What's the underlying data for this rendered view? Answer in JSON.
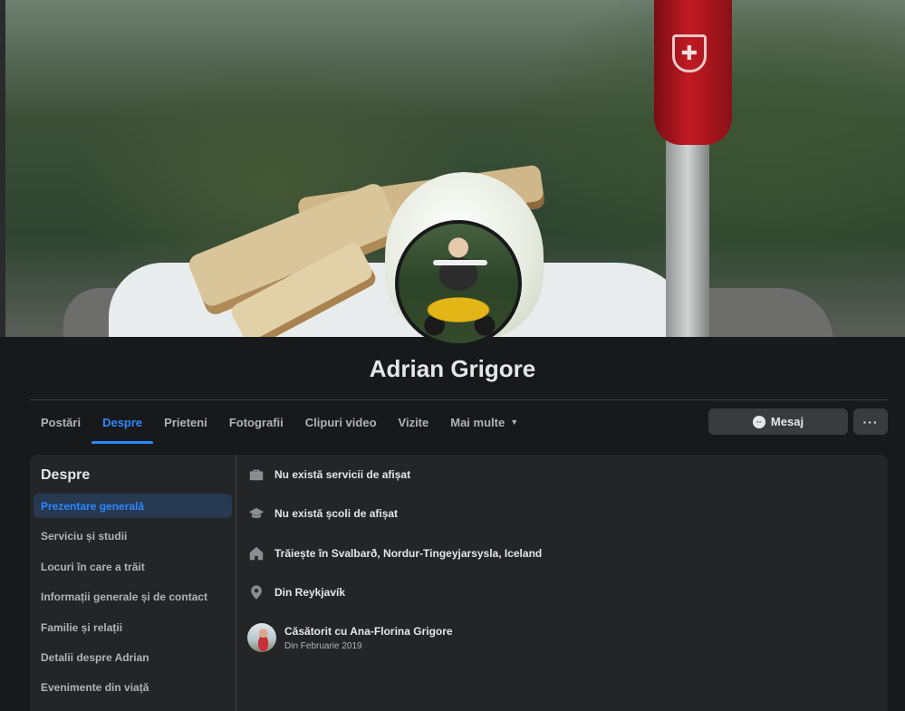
{
  "profile": {
    "name": "Adrian Grigore"
  },
  "tabs": [
    {
      "label": "Postări"
    },
    {
      "label": "Despre"
    },
    {
      "label": "Prieteni"
    },
    {
      "label": "Fotografii"
    },
    {
      "label": "Clipuri video"
    },
    {
      "label": "Vizite"
    },
    {
      "label": "Mai multe"
    }
  ],
  "actions": {
    "message_label": "Mesaj",
    "more_label": "···"
  },
  "about": {
    "title": "Despre",
    "menu": [
      {
        "label": "Prezentare generală"
      },
      {
        "label": "Serviciu și studii"
      },
      {
        "label": "Locuri în care a trăit"
      },
      {
        "label": "Informații generale și de contact"
      },
      {
        "label": "Familie și relații"
      },
      {
        "label": "Detalii despre Adrian"
      },
      {
        "label": "Evenimente din viață"
      }
    ],
    "overview": [
      {
        "icon": "briefcase-icon",
        "text": "Nu există servicii de afișat"
      },
      {
        "icon": "graduation-cap-icon",
        "text": "Nu există școli de afișat"
      },
      {
        "icon": "home-icon",
        "text": "Trăiește în Svalbarð, Nordur-Tingeyjarsysla, Iceland"
      },
      {
        "icon": "location-pin-icon",
        "text": "Din Reykjavík"
      }
    ],
    "relationship": {
      "text": "Căsătorit cu Ana-Florina Grigore",
      "since": "Din Februarie 2019"
    }
  },
  "colors": {
    "accent": "#2d88ff",
    "background": "#18191a",
    "card": "#242526"
  }
}
